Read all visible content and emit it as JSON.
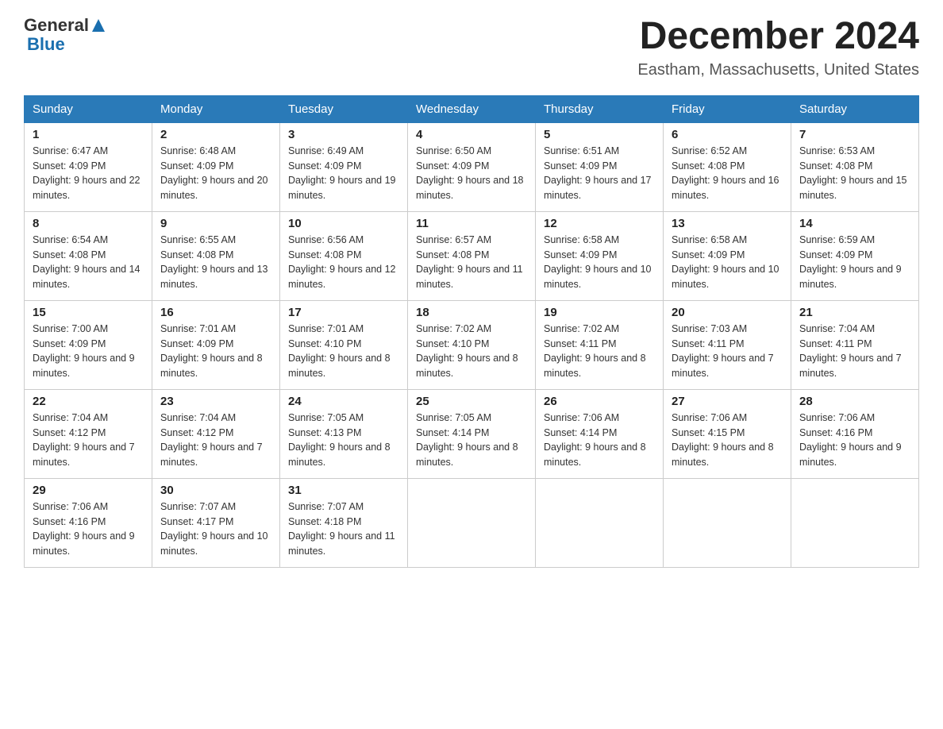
{
  "header": {
    "logo": {
      "text_general": "General",
      "text_blue": "Blue",
      "arrow_label": "arrow-icon"
    },
    "title": "December 2024",
    "subtitle": "Eastham, Massachusetts, United States"
  },
  "weekdays": [
    "Sunday",
    "Monday",
    "Tuesday",
    "Wednesday",
    "Thursday",
    "Friday",
    "Saturday"
  ],
  "weeks": [
    [
      {
        "day": "1",
        "sunrise": "6:47 AM",
        "sunset": "4:09 PM",
        "daylight": "9 hours and 22 minutes."
      },
      {
        "day": "2",
        "sunrise": "6:48 AM",
        "sunset": "4:09 PM",
        "daylight": "9 hours and 20 minutes."
      },
      {
        "day": "3",
        "sunrise": "6:49 AM",
        "sunset": "4:09 PM",
        "daylight": "9 hours and 19 minutes."
      },
      {
        "day": "4",
        "sunrise": "6:50 AM",
        "sunset": "4:09 PM",
        "daylight": "9 hours and 18 minutes."
      },
      {
        "day": "5",
        "sunrise": "6:51 AM",
        "sunset": "4:09 PM",
        "daylight": "9 hours and 17 minutes."
      },
      {
        "day": "6",
        "sunrise": "6:52 AM",
        "sunset": "4:08 PM",
        "daylight": "9 hours and 16 minutes."
      },
      {
        "day": "7",
        "sunrise": "6:53 AM",
        "sunset": "4:08 PM",
        "daylight": "9 hours and 15 minutes."
      }
    ],
    [
      {
        "day": "8",
        "sunrise": "6:54 AM",
        "sunset": "4:08 PM",
        "daylight": "9 hours and 14 minutes."
      },
      {
        "day": "9",
        "sunrise": "6:55 AM",
        "sunset": "4:08 PM",
        "daylight": "9 hours and 13 minutes."
      },
      {
        "day": "10",
        "sunrise": "6:56 AM",
        "sunset": "4:08 PM",
        "daylight": "9 hours and 12 minutes."
      },
      {
        "day": "11",
        "sunrise": "6:57 AM",
        "sunset": "4:08 PM",
        "daylight": "9 hours and 11 minutes."
      },
      {
        "day": "12",
        "sunrise": "6:58 AM",
        "sunset": "4:09 PM",
        "daylight": "9 hours and 10 minutes."
      },
      {
        "day": "13",
        "sunrise": "6:58 AM",
        "sunset": "4:09 PM",
        "daylight": "9 hours and 10 minutes."
      },
      {
        "day": "14",
        "sunrise": "6:59 AM",
        "sunset": "4:09 PM",
        "daylight": "9 hours and 9 minutes."
      }
    ],
    [
      {
        "day": "15",
        "sunrise": "7:00 AM",
        "sunset": "4:09 PM",
        "daylight": "9 hours and 9 minutes."
      },
      {
        "day": "16",
        "sunrise": "7:01 AM",
        "sunset": "4:09 PM",
        "daylight": "9 hours and 8 minutes."
      },
      {
        "day": "17",
        "sunrise": "7:01 AM",
        "sunset": "4:10 PM",
        "daylight": "9 hours and 8 minutes."
      },
      {
        "day": "18",
        "sunrise": "7:02 AM",
        "sunset": "4:10 PM",
        "daylight": "9 hours and 8 minutes."
      },
      {
        "day": "19",
        "sunrise": "7:02 AM",
        "sunset": "4:11 PM",
        "daylight": "9 hours and 8 minutes."
      },
      {
        "day": "20",
        "sunrise": "7:03 AM",
        "sunset": "4:11 PM",
        "daylight": "9 hours and 7 minutes."
      },
      {
        "day": "21",
        "sunrise": "7:04 AM",
        "sunset": "4:11 PM",
        "daylight": "9 hours and 7 minutes."
      }
    ],
    [
      {
        "day": "22",
        "sunrise": "7:04 AM",
        "sunset": "4:12 PM",
        "daylight": "9 hours and 7 minutes."
      },
      {
        "day": "23",
        "sunrise": "7:04 AM",
        "sunset": "4:12 PM",
        "daylight": "9 hours and 7 minutes."
      },
      {
        "day": "24",
        "sunrise": "7:05 AM",
        "sunset": "4:13 PM",
        "daylight": "9 hours and 8 minutes."
      },
      {
        "day": "25",
        "sunrise": "7:05 AM",
        "sunset": "4:14 PM",
        "daylight": "9 hours and 8 minutes."
      },
      {
        "day": "26",
        "sunrise": "7:06 AM",
        "sunset": "4:14 PM",
        "daylight": "9 hours and 8 minutes."
      },
      {
        "day": "27",
        "sunrise": "7:06 AM",
        "sunset": "4:15 PM",
        "daylight": "9 hours and 8 minutes."
      },
      {
        "day": "28",
        "sunrise": "7:06 AM",
        "sunset": "4:16 PM",
        "daylight": "9 hours and 9 minutes."
      }
    ],
    [
      {
        "day": "29",
        "sunrise": "7:06 AM",
        "sunset": "4:16 PM",
        "daylight": "9 hours and 9 minutes."
      },
      {
        "day": "30",
        "sunrise": "7:07 AM",
        "sunset": "4:17 PM",
        "daylight": "9 hours and 10 minutes."
      },
      {
        "day": "31",
        "sunrise": "7:07 AM",
        "sunset": "4:18 PM",
        "daylight": "9 hours and 11 minutes."
      },
      null,
      null,
      null,
      null
    ]
  ]
}
